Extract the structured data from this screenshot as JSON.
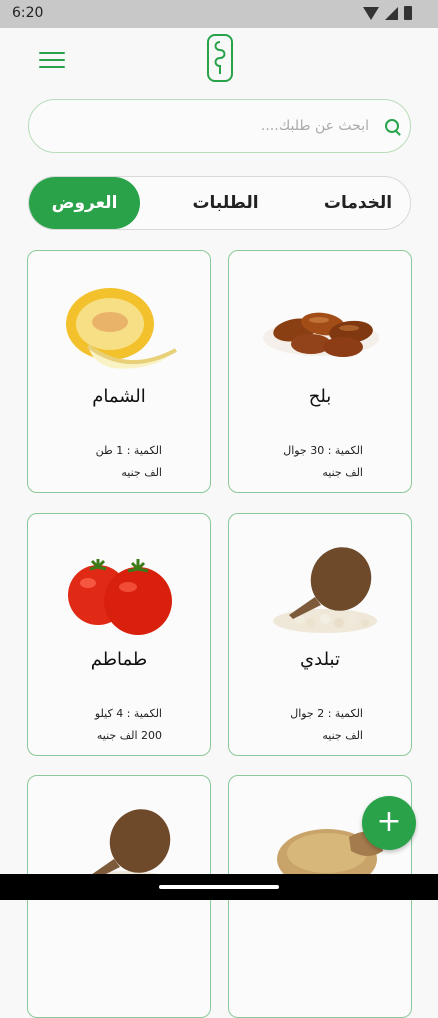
{
  "status": {
    "time": "6:20"
  },
  "search": {
    "placeholder": "ابحث عن طلبك...."
  },
  "tabs": [
    {
      "label": "الخدمات"
    },
    {
      "label": "الطلبات"
    },
    {
      "label": "العروض",
      "active": true
    }
  ],
  "products": [
    {
      "name": "بلح",
      "quantity": "الكمية :  30 جوال",
      "price": "الف جنيه"
    },
    {
      "name": "الشمام",
      "quantity": "الكمية :  1 طن",
      "price": "الف جنيه"
    },
    {
      "name": "تبلدي",
      "quantity": "الكمية :  2 جوال",
      "price": "الف جنيه"
    },
    {
      "name": "طماطم",
      "quantity": "الكمية :  4 كيلو",
      "price": "200 الف جنيه"
    }
  ],
  "fab": {
    "label": "+"
  },
  "colors": {
    "accent": "#2aa24a"
  }
}
